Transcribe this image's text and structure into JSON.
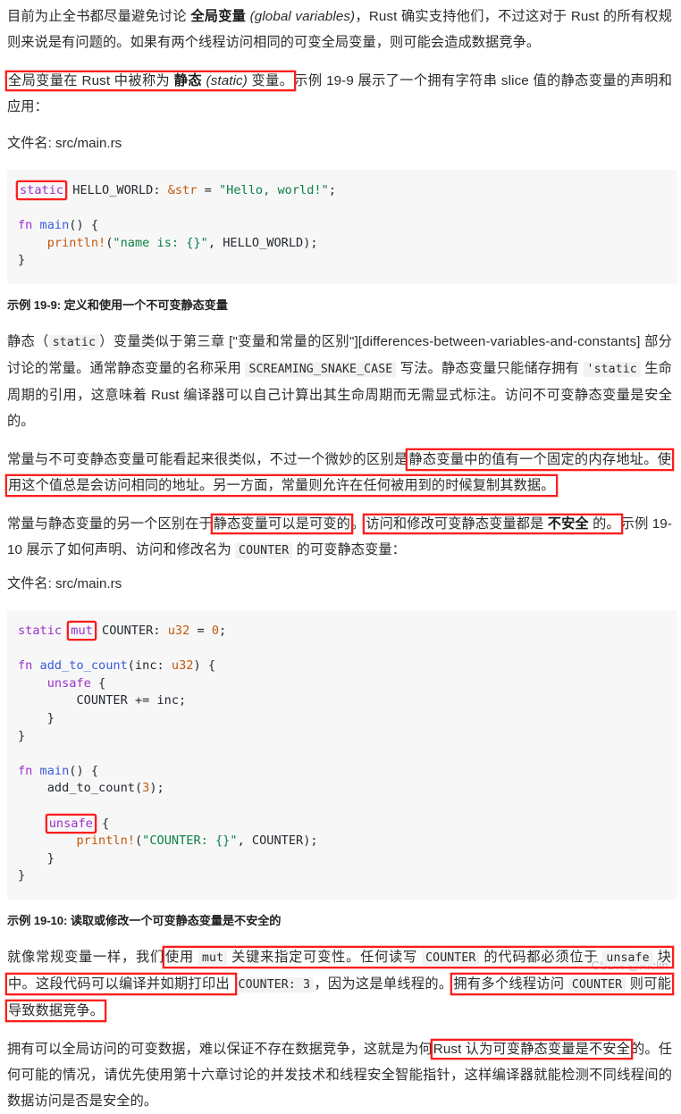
{
  "document": {
    "watermark": "CSDN @Aiclin"
  },
  "paragraphs": {
    "intro": {
      "seg1": "目前为止全书都尽量避免讨论 ",
      "bold_global": "全局变量",
      "seg2": " ",
      "italic_global": "(global variables)",
      "seg3": "，Rust 确实支持他们，不过这对于 Rust 的所有权规则来说是有问题的。如果有两个线程访问相同的可变全局变量，则可能会造成数据竞争。"
    },
    "static_intro": {
      "hl_seg1": "全局变量在 Rust 中被称为 ",
      "hl_bold": "静态",
      "hl_seg2": " ",
      "hl_italic": "(static)",
      "hl_seg3": " 变量。",
      "rest": "示例 19-9 展示了一个拥有字符串 slice 值的静态变量的声明和应用："
    },
    "similar_const": {
      "seg1": "静态（",
      "code1": "static",
      "seg2": "）变量类似于第三章 [\"变量和常量的区别\"][differences-between-variables-and-constants] 部分讨论的常量。通常静态变量的名称采用 ",
      "code2": "SCREAMING_SNAKE_CASE",
      "seg3": " 写法。静态变量只能储存拥有 ",
      "code3": "'static",
      "seg4": " 生命周期的引用，这意味着 Rust 编译器可以自己计算出其生命周期而无需显式标注。访问不可变静态变量是安全的。"
    },
    "memory_address": {
      "seg1": "常量与不可变静态变量可能看起来很类似，不过一个微妙的区别是",
      "highlight": "静态变量中的值有一个固定的内存地址。使用这个值总是会访问相同的地址。另一方面，常量则允许在任何被用到的时候复制其数据。"
    },
    "mutable_diff": {
      "seg1": "常量与静态变量的另一个区别在于",
      "hl_a": "静态变量可以是可变的",
      "seg2": "。",
      "hl_b_pre": "访问和修改可变静态变量都是 ",
      "hl_b_bold": "不安全",
      "hl_b_post": " 的。",
      "seg3": "示例 19-10 展示了如何声明、访问和修改名为 ",
      "code1": "COUNTER",
      "seg4": " 的可变静态变量："
    },
    "explain_mut": {
      "seg1": "就像常规变量一样，我们",
      "hl1_a": "使用 ",
      "hl1_code1": "mut",
      "hl1_b": " 关键来指定可变性。任何读写 ",
      "hl1_code2": "COUNTER",
      "hl1_c": " 的代码都必须位于 ",
      "hl1_code3": "unsafe",
      "hl1_d": " 块中。这段代码可以编译并如期打印出 ",
      "seg_code_counter3": "COUNTER: 3",
      "seg2": "，因为这是单线程的。",
      "hl2_a": "拥有多个线程访问 ",
      "hl2_code": "COUNTER",
      "hl2_b": " 则可能导致数据竞争。"
    },
    "conclusion": {
      "seg1": "拥有可以全局访问的可变数据，难以保证不存在数据竞争，这就是为何",
      "highlight": "Rust 认为可变静态变量是不安全",
      "seg2": "的。任何可能的情况，请优先使用第十六章讨论的并发技术和线程安全智能指针，这样编译器就能检测不同线程间的数据访问是否是安全的。"
    }
  },
  "filenames": {
    "first": "文件名: src/main.rs",
    "second": "文件名: src/main.rs"
  },
  "captions": {
    "listing_19_9": "示例 19-9: 定义和使用一个不可变静态变量",
    "listing_19_10": "示例 19-10: 读取或修改一个可变静态变量是不安全的"
  },
  "code_blocks": {
    "listing_19_9": {
      "kw_static": "static",
      "l1_rest_a": " HELLO_WORLD: ",
      "l1_type": "&str",
      "l1_eq": " = ",
      "l1_str": "\"Hello, world!\"",
      "l1_semi": ";",
      "l3_fn": "fn",
      "l3_name": " main",
      "l3_rest": "() {",
      "l4_indent": "    ",
      "l4_mac": "println!",
      "l4_open": "(",
      "l4_str": "\"name is: {}\"",
      "l4_rest": ", HELLO_WORLD);",
      "l5_close": "}"
    },
    "listing_19_10": {
      "l1_static": "static",
      "l1_sp": " ",
      "l1_mut": "mut",
      "l1_rest_a": " COUNTER: ",
      "l1_type": "u32",
      "l1_eq": " = ",
      "l1_num": "0",
      "l1_semi": ";",
      "l3_fn": "fn",
      "l3_name": " add_to_count",
      "l3_open": "(inc: ",
      "l3_type": "u32",
      "l3_close": ") {",
      "l4_unsafe": "    unsafe",
      "l4_rest": " {",
      "l5": "        COUNTER += inc;",
      "l6": "    }",
      "l7": "}",
      "l9_fn": "fn",
      "l9_name": " main",
      "l9_rest": "() {",
      "l10_a": "    add_to_count(",
      "l10_num": "3",
      "l10_b": ");",
      "l12_indent": "    ",
      "l12_unsafe": "unsafe",
      "l12_rest": " {",
      "l13_indent": "        ",
      "l13_mac": "println!",
      "l13_open": "(",
      "l13_str": "\"COUNTER: {}\"",
      "l13_rest": ", COUNTER);",
      "l14": "    }",
      "l15": "}"
    }
  },
  "colors": {
    "annotation_red": "#fd1d1d",
    "code_bg": "#f7f7f8",
    "keyword_purple": "#9b30c9",
    "string_green": "#0b8043",
    "type_orange": "#c2590a",
    "function_blue": "#3b5bdb",
    "text": "#2b2b2b",
    "watermark": "#b9b9b9"
  }
}
